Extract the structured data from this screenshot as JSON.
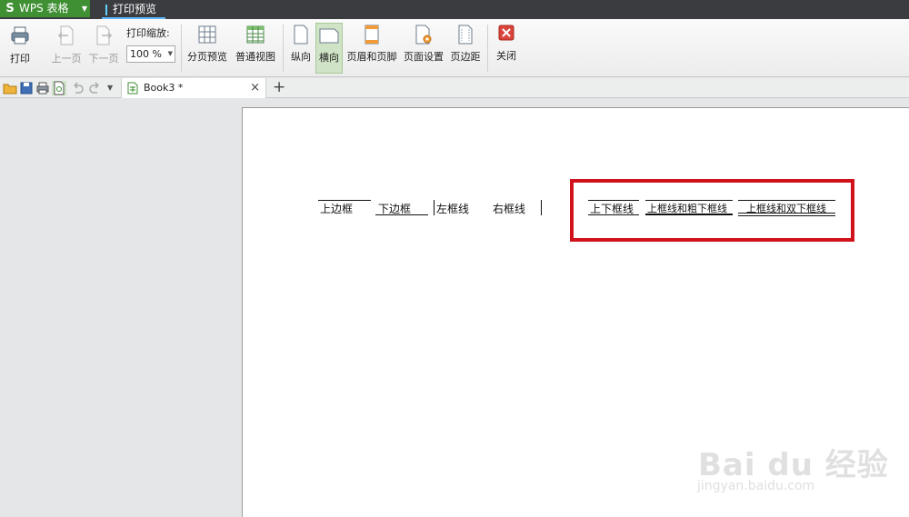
{
  "titlebar": {
    "app_logo": "S",
    "app_name": "WPS 表格",
    "tab": "打印预览"
  },
  "ribbon": {
    "print": "打印",
    "prev_page": "上一页",
    "next_page": "下一页",
    "zoom_label": "打印缩放:",
    "zoom_value": "100 %",
    "page_break_preview": "分页预览",
    "normal_view": "普通视图",
    "portrait": "纵向",
    "landscape": "横向",
    "header_footer": "页眉和页脚",
    "page_setup": "页面设置",
    "margins": "页边距",
    "close": "关闭"
  },
  "tabs": {
    "doc_name": "Book3 *",
    "close_symbol": "×",
    "add_symbol": "+"
  },
  "sheet": {
    "top_border": "上边框",
    "bottom_border": "下边框",
    "left_border": "左框线",
    "right_border": "右框线",
    "top_bottom": "上下框线",
    "top_thick_bottom": "上框线和粗下框线",
    "top_double_bottom": "上框线和双下框线"
  },
  "watermark": {
    "brand": "Bai du 经验",
    "url": "jingyan.baidu.com"
  },
  "colors": {
    "accent_green": "#3f8f33",
    "highlight_red": "#d0121b",
    "titlebar": "#3a3c40"
  }
}
